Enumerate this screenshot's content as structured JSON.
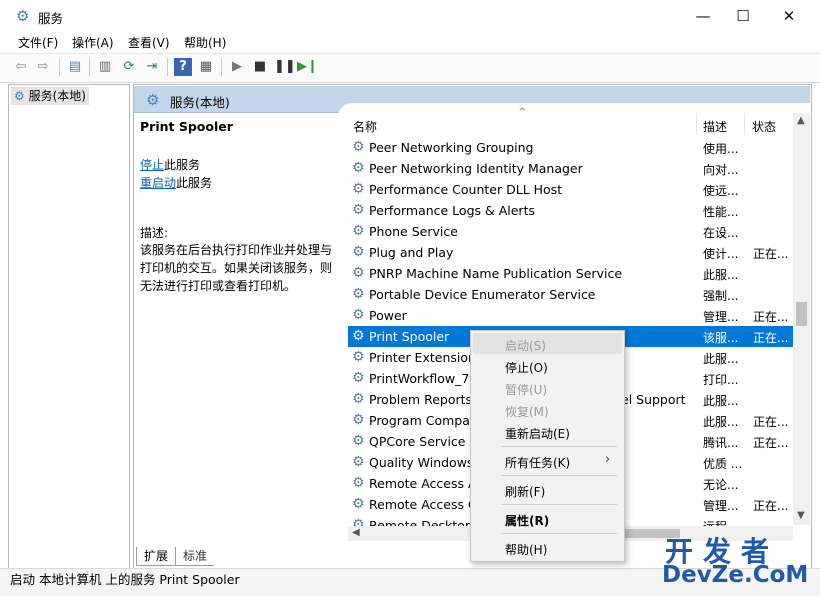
{
  "window": {
    "title": "服务",
    "minimize": "—",
    "maximize": "☐",
    "close": "✕"
  },
  "menu": [
    "文件(F)",
    "操作(A)",
    "查看(V)",
    "帮助(H)"
  ],
  "tree": {
    "item": "服务(本地)"
  },
  "banner": {
    "title": "服务(本地)"
  },
  "detail": {
    "service_name": "Print Spooler",
    "stop_link": "停止",
    "stop_suffix": "此服务",
    "restart_link": "重启动",
    "restart_suffix": "此服务",
    "desc_label": "描述:",
    "desc_text": "该服务在后台执行打印作业并处理与打印机的交互。如果关闭该服务，则无法进行打印或查看打印机。"
  },
  "columns": {
    "name": "名称",
    "desc": "描述",
    "status": "状态"
  },
  "services": [
    {
      "name": "Peer Networking Grouping",
      "desc": "使用...",
      "status": ""
    },
    {
      "name": "Peer Networking Identity Manager",
      "desc": "向对...",
      "status": ""
    },
    {
      "name": "Performance Counter DLL Host",
      "desc": "使远...",
      "status": ""
    },
    {
      "name": "Performance Logs & Alerts",
      "desc": "性能...",
      "status": ""
    },
    {
      "name": "Phone Service",
      "desc": "在设...",
      "status": ""
    },
    {
      "name": "Plug and Play",
      "desc": "使计...",
      "status": "正在..."
    },
    {
      "name": "PNRP Machine Name Publication Service",
      "desc": "此服...",
      "status": ""
    },
    {
      "name": "Portable Device Enumerator Service",
      "desc": "强制...",
      "status": ""
    },
    {
      "name": "Power",
      "desc": "管理...",
      "status": "正在..."
    },
    {
      "name": "Print Spooler",
      "desc": "该服...",
      "status": "正在...",
      "selected": true
    },
    {
      "name": "Printer Extensions",
      "desc": "此服...",
      "status": ""
    },
    {
      "name": "PrintWorkflow_7fa",
      "desc": "打印...",
      "status": ""
    },
    {
      "name": "Problem Reports",
      "desc": "此服...",
      "status": "",
      "extra": "el Support"
    },
    {
      "name": "Program Compat",
      "desc": "此服...",
      "status": "正在..."
    },
    {
      "name": "QPCore Service",
      "desc": "腾讯...",
      "status": "正在..."
    },
    {
      "name": "Quality Windows",
      "desc": "优质 ...",
      "status": ""
    },
    {
      "name": "Remote Access A",
      "desc": "无论...",
      "status": ""
    },
    {
      "name": "Remote Access C",
      "desc": "管理...",
      "status": "正在..."
    },
    {
      "name": "Remote Desktop",
      "desc": "远程...",
      "status": ""
    }
  ],
  "context_menu": [
    {
      "label": "启动(S)",
      "disabled": true
    },
    {
      "label": "停止(O)",
      "disabled": false
    },
    {
      "label": "暂停(U)",
      "disabled": true
    },
    {
      "label": "恢复(M)",
      "disabled": true
    },
    {
      "label": "重新启动(E)",
      "disabled": false
    },
    {
      "label": "所有任务(K)",
      "disabled": false
    },
    {
      "label": "刷新(F)",
      "disabled": false
    },
    {
      "label": "属性(R)",
      "disabled": false
    },
    {
      "label": "帮助(H)",
      "disabled": false
    }
  ],
  "tabs": [
    "扩展",
    "标准"
  ],
  "status": "启动 本地计算机 上的服务 Print Spooler",
  "watermark": {
    "top": "开发者",
    "bottom": "DevZe.CoM"
  },
  "colors": {
    "selection": "#0078d7",
    "banner": "#c2d5ea",
    "link": "#0b62b5"
  }
}
